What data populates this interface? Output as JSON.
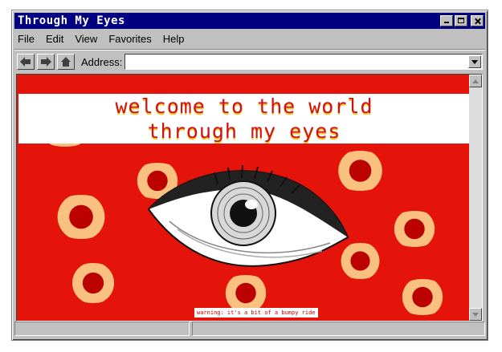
{
  "window": {
    "title": "Through My Eyes"
  },
  "menubar": {
    "items": [
      "File",
      "Edit",
      "View",
      "Favorites",
      "Help"
    ]
  },
  "toolbar": {
    "address_label": "Address:",
    "address_value": ""
  },
  "page": {
    "headline_line1": "welcome to the world",
    "headline_line2": "through my eyes",
    "warning": "warning: it's a bit of a bumpy ride"
  },
  "status": {
    "left": "",
    "right": ""
  },
  "colors": {
    "titlebar": "#000080",
    "chrome": "#c0c0c0",
    "page_red": "#e5140a",
    "headline_red": "#d2101a",
    "headline_shadow": "#f2c81e"
  },
  "icons": [
    "back-arrow-icon",
    "forward-arrow-icon",
    "home-icon",
    "chevron-down-icon",
    "scroll-up-icon",
    "scroll-down-icon"
  ]
}
